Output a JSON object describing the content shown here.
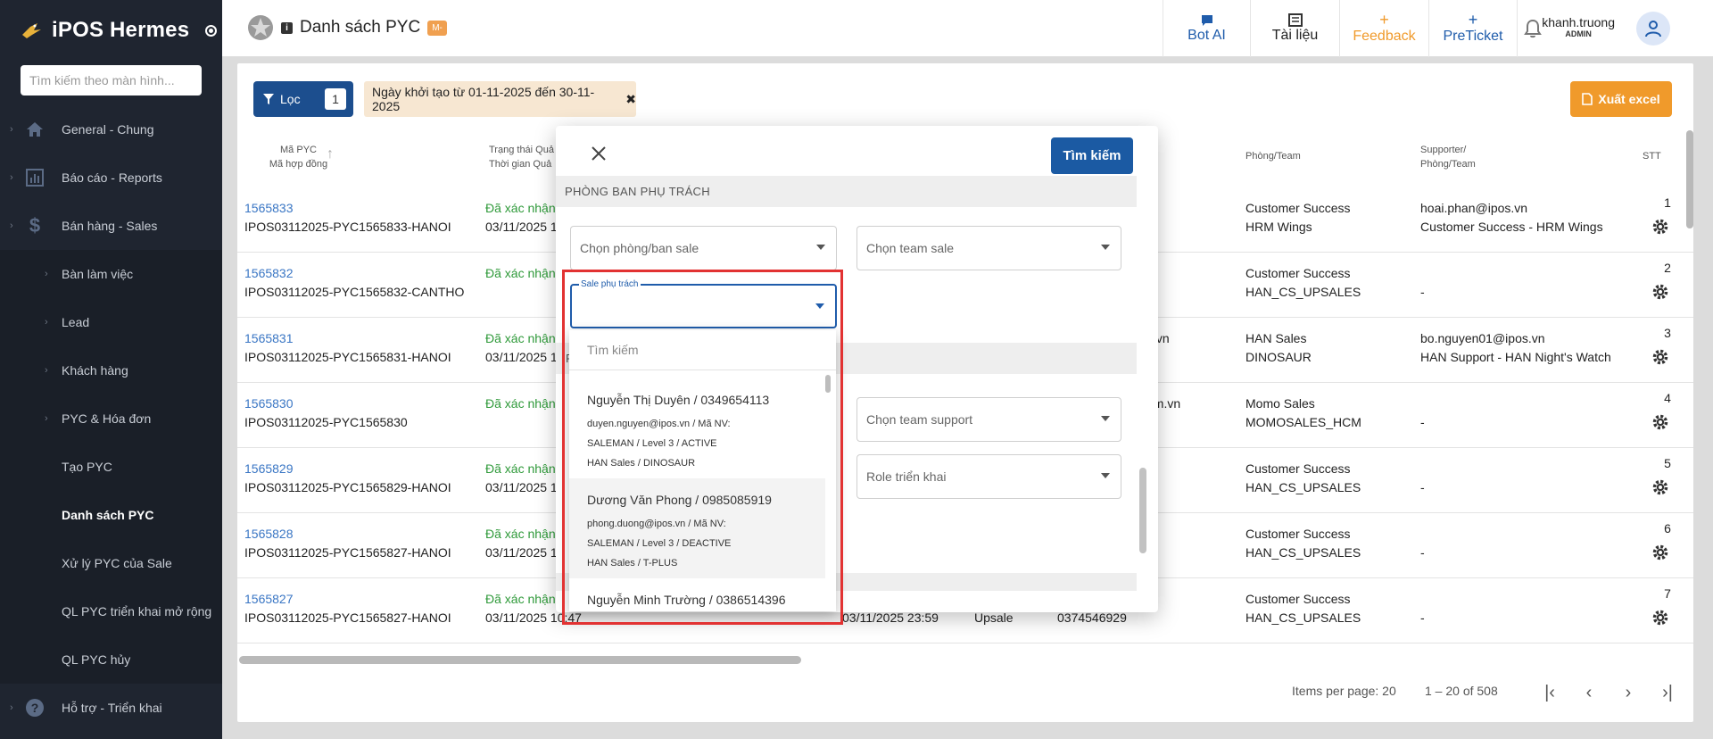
{
  "brand": {
    "name": "iPOS Hermes"
  },
  "sidebar": {
    "search_placeholder": "Tìm kiếm theo màn hình...",
    "items": [
      {
        "label": "General - Chung",
        "icon": "home-icon"
      },
      {
        "label": "Báo cáo - Reports",
        "icon": "report-icon"
      },
      {
        "label": "Bán hàng - Sales",
        "icon": "dollar-icon"
      },
      {
        "label": "Bàn làm việc"
      },
      {
        "label": "Lead"
      },
      {
        "label": "Khách hàng"
      },
      {
        "label": "PYC & Hóa đơn"
      },
      {
        "label": "Tạo PYC"
      },
      {
        "label": "Danh sách PYC"
      },
      {
        "label": "Xử lý PYC của Sale"
      },
      {
        "label": "QL PYC triển khai mở rộng"
      },
      {
        "label": "QL PYC hủy"
      },
      {
        "label": "Hỗ trợ - Triển khai",
        "icon": "help-icon"
      }
    ]
  },
  "header": {
    "title": "Danh sách PYC",
    "info_badge": "i",
    "m_badge": "M-",
    "actions": {
      "bot": "Bot AI",
      "docs": "Tài liệu",
      "feedback_glyph": "+",
      "feedback": "Feedback",
      "preticket_glyph": "+",
      "preticket": "PreTicket"
    },
    "user": {
      "name": "khanh.truong",
      "role": "ADMIN"
    }
  },
  "toolbar": {
    "filter_label": "Lọc",
    "filter_count": "1",
    "filter_chip": "Ngày khởi tạo từ 01-11-2025 đến 30-11-2025",
    "export_label": "Xuất excel"
  },
  "table": {
    "headers": {
      "code": "Mã PYC",
      "contract": "Mã hợp đồng",
      "status": "Trạng thái Quả",
      "status_time": "Thời gian Quả",
      "team": "Phòng/Team",
      "supporter": "Supporter/",
      "supporter_team": "Phòng/Team",
      "stt": "STT"
    },
    "rows": [
      {
        "id": "1565833",
        "contract": "IPOS03112025-PYC1565833-HANOI",
        "status": "Đã xác nhận",
        "time": "03/11/2025 1",
        "mid": "",
        "team1": "Customer Success",
        "team2": "HRM Wings",
        "sup1": "hoai.phan@ipos.vn",
        "sup2": "Customer Success - HRM Wings",
        "stt": "1"
      },
      {
        "id": "1565832",
        "contract": "IPOS03112025-PYC1565832-CANTHO",
        "status": "Đã xác nhận",
        "time": "",
        "mid": "",
        "team1": "Customer Success",
        "team2": "HAN_CS_UPSALES",
        "sup1": "",
        "sup2": "-",
        "stt": "2"
      },
      {
        "id": "1565831",
        "contract": "IPOS03112025-PYC1565831-HANOI",
        "status": "Đã xác nhận",
        "time": "03/11/2025 1",
        "mid": "s.vn",
        "team1": "HAN Sales",
        "team2": "DINOSAUR",
        "sup1": "bo.nguyen01@ipos.vn",
        "sup2": "HAN Support - HAN Night's Watch",
        "stt": "3"
      },
      {
        "id": "1565830",
        "contract": "IPOS03112025-PYC1565830",
        "status": "Đã xác nhận",
        "time": "",
        "mid": "om.vn",
        "team1": "Momo Sales",
        "team2": "MOMOSALES_HCM",
        "sup1": "",
        "sup2": "-",
        "stt": "4"
      },
      {
        "id": "1565829",
        "contract": "IPOS03112025-PYC1565829-HANOI",
        "status": "Đã xác nhận",
        "time": "03/11/2025 1",
        "mid": "",
        "team1": "Customer Success",
        "team2": "HAN_CS_UPSALES",
        "sup1": "",
        "sup2": "-",
        "stt": "5"
      },
      {
        "id": "1565828",
        "contract": "IPOS03112025-PYC1565827-HANOI",
        "status": "Đã xác nhận",
        "time": "03/11/2025 1",
        "mid": "",
        "team1": "Customer Success",
        "team2": "HAN_CS_UPSALES",
        "sup1": "",
        "sup2": "-",
        "stt": "6"
      },
      {
        "id": "1565827",
        "contract": "IPOS03112025-PYC1565827-HANOI",
        "status": "Đã xác nhận",
        "time": "03/11/2025 10:47",
        "extra_date": "03/11/2025 23:59",
        "extra_type": "Upsale",
        "extra_phone": "0374546929",
        "mid": "",
        "team1": "Customer Success",
        "team2": "HAN_CS_UPSALES",
        "sup1": "",
        "sup2": "-",
        "stt": "7"
      }
    ]
  },
  "pagination": {
    "items_per_page": "Items per page: 20",
    "range": "1 – 20 of 508"
  },
  "modal": {
    "search_button": "Tìm kiếm",
    "section_title": "PHÒNG BAN PHỤ TRÁCH",
    "sale_dept_placeholder": "Chọn phòng/ban sale",
    "sale_team_placeholder": "Chọn team sale",
    "sale_owner_label": "Sale phụ trách",
    "support_team_placeholder": "Chọn team support",
    "role_placeholder": "Role triển khai",
    "hidden_letter": "P"
  },
  "dropdown": {
    "search_placeholder": "Tìm kiếm",
    "items": [
      {
        "name": "Nguyễn Thị Duyên / 0349654113",
        "line1": "duyen.nguyen@ipos.vn / Mã NV:",
        "line2": "SALEMAN / Level 3 / ACTIVE",
        "line3": "HAN Sales / DINOSAUR"
      },
      {
        "name": "Dương Văn Phong / 0985085919",
        "line1": "phong.duong@ipos.vn / Mã NV:",
        "line2": "SALEMAN / Level 3 / DEACTIVE",
        "line3": "HAN Sales / T-PLUS"
      },
      {
        "name": "Nguyễn Minh Trường / 0386514396",
        "line1": "",
        "line2": "",
        "line3": ""
      }
    ]
  },
  "colors": {
    "sidebar": "#1f2530",
    "primary": "#1c4e8e",
    "export": "#f09a2b",
    "link": "#3a76c4",
    "status_green": "#2f9a3a",
    "highlight_outline": "#e23232"
  }
}
